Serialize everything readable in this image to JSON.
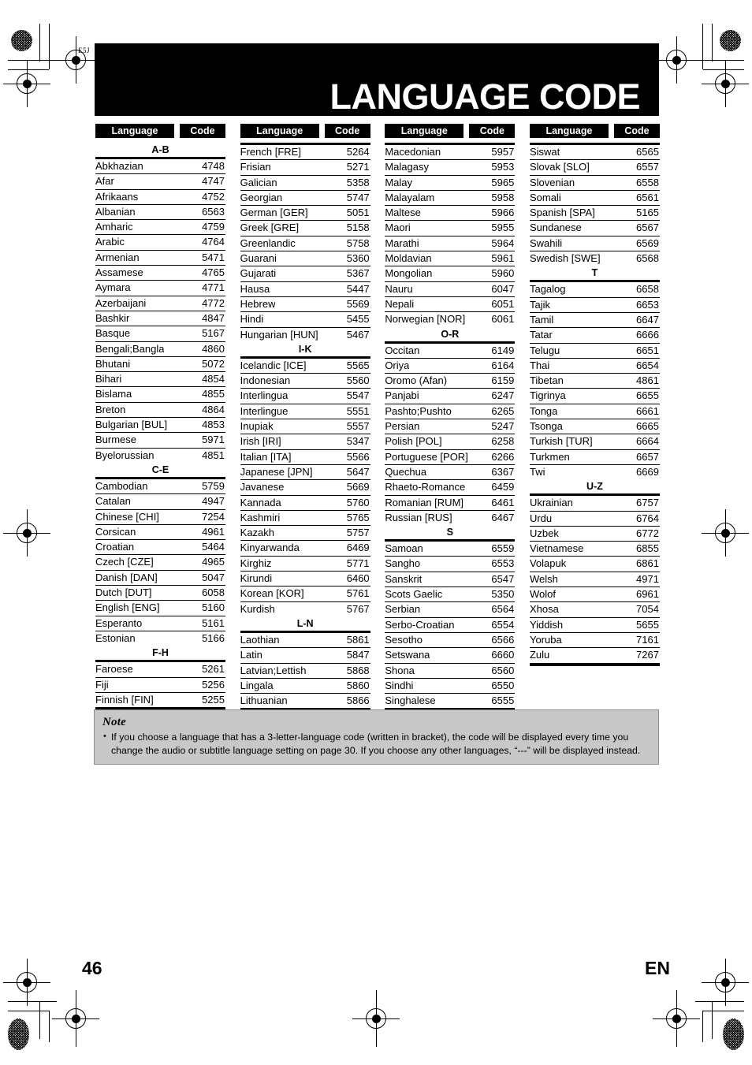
{
  "document": {
    "title": "LANGUAGE CODE",
    "corner_mark": "E5J",
    "page_number": "46",
    "page_language": "EN"
  },
  "table": {
    "header": {
      "language": "Language",
      "code": "Code"
    },
    "columns": [
      {
        "groups": [
          {
            "section": "A-B",
            "rows": [
              {
                "language": "Abkhazian",
                "code": "4748"
              },
              {
                "language": "Afar",
                "code": "4747"
              },
              {
                "language": "Afrikaans",
                "code": "4752"
              },
              {
                "language": "Albanian",
                "code": "6563"
              },
              {
                "language": "Amharic",
                "code": "4759"
              },
              {
                "language": "Arabic",
                "code": "4764"
              },
              {
                "language": "Armenian",
                "code": "5471"
              },
              {
                "language": "Assamese",
                "code": "4765"
              },
              {
                "language": "Aymara",
                "code": "4771"
              },
              {
                "language": "Azerbaijani",
                "code": "4772"
              },
              {
                "language": "Bashkir",
                "code": "4847"
              },
              {
                "language": "Basque",
                "code": "5167"
              },
              {
                "language": "Bengali;Bangla",
                "code": "4860"
              },
              {
                "language": "Bhutani",
                "code": "5072"
              },
              {
                "language": "Bihari",
                "code": "4854"
              },
              {
                "language": "Bislama",
                "code": "4855"
              },
              {
                "language": "Breton",
                "code": "4864"
              },
              {
                "language": "Bulgarian [BUL]",
                "code": "4853"
              },
              {
                "language": "Burmese",
                "code": "5971"
              },
              {
                "language": "Byelorussian",
                "code": "4851"
              }
            ]
          },
          {
            "section": "C-E",
            "rows": [
              {
                "language": "Cambodian",
                "code": "5759"
              },
              {
                "language": "Catalan",
                "code": "4947"
              },
              {
                "language": "Chinese [CHI]",
                "code": "7254"
              },
              {
                "language": "Corsican",
                "code": "4961"
              },
              {
                "language": "Croatian",
                "code": "5464"
              },
              {
                "language": "Czech [CZE]",
                "code": "4965"
              },
              {
                "language": "Danish [DAN]",
                "code": "5047"
              },
              {
                "language": "Dutch [DUT]",
                "code": "6058"
              },
              {
                "language": "English [ENG]",
                "code": "5160"
              },
              {
                "language": "Esperanto",
                "code": "5161"
              },
              {
                "language": "Estonian",
                "code": "5166"
              }
            ]
          },
          {
            "section": "F-H",
            "rows": [
              {
                "language": "Faroese",
                "code": "5261"
              },
              {
                "language": "Fiji",
                "code": "5256"
              },
              {
                "language": "Finnish [FIN]",
                "code": "5255"
              }
            ]
          }
        ]
      },
      {
        "groups": [
          {
            "section": "",
            "rows": [
              {
                "language": "French [FRE]",
                "code": "5264"
              },
              {
                "language": "Frisian",
                "code": "5271"
              },
              {
                "language": "Galician",
                "code": "5358"
              },
              {
                "language": "Georgian",
                "code": "5747"
              },
              {
                "language": "German [GER]",
                "code": "5051"
              },
              {
                "language": "Greek [GRE]",
                "code": "5158"
              },
              {
                "language": "Greenlandic",
                "code": "5758"
              },
              {
                "language": "Guarani",
                "code": "5360"
              },
              {
                "language": "Gujarati",
                "code": "5367"
              },
              {
                "language": "Hausa",
                "code": "5447"
              },
              {
                "language": "Hebrew",
                "code": "5569"
              },
              {
                "language": "Hindi",
                "code": "5455"
              },
              {
                "language": "Hungarian [HUN]",
                "code": "5467"
              }
            ]
          },
          {
            "section": "I-K",
            "rows": [
              {
                "language": "Icelandic [ICE]",
                "code": "5565"
              },
              {
                "language": "Indonesian",
                "code": "5560"
              },
              {
                "language": "Interlingua",
                "code": "5547"
              },
              {
                "language": "Interlingue",
                "code": "5551"
              },
              {
                "language": "Inupiak",
                "code": "5557"
              },
              {
                "language": "Irish [IRI]",
                "code": "5347"
              },
              {
                "language": "Italian [ITA]",
                "code": "5566"
              },
              {
                "language": "Japanese [JPN]",
                "code": "5647"
              },
              {
                "language": "Javanese",
                "code": "5669"
              },
              {
                "language": "Kannada",
                "code": "5760"
              },
              {
                "language": "Kashmiri",
                "code": "5765"
              },
              {
                "language": "Kazakh",
                "code": "5757"
              },
              {
                "language": "Kinyarwanda",
                "code": "6469"
              },
              {
                "language": "Kirghiz",
                "code": "5771"
              },
              {
                "language": "Kirundi",
                "code": "6460"
              },
              {
                "language": "Korean [KOR]",
                "code": "5761"
              },
              {
                "language": "Kurdish",
                "code": "5767"
              }
            ]
          },
          {
            "section": "L-N",
            "rows": [
              {
                "language": "Laothian",
                "code": "5861"
              },
              {
                "language": "Latin",
                "code": "5847"
              },
              {
                "language": "Latvian;Lettish",
                "code": "5868"
              },
              {
                "language": "Lingala",
                "code": "5860"
              },
              {
                "language": "Lithuanian",
                "code": "5866"
              }
            ]
          }
        ]
      },
      {
        "groups": [
          {
            "section": "",
            "rows": [
              {
                "language": "Macedonian",
                "code": "5957"
              },
              {
                "language": "Malagasy",
                "code": "5953"
              },
              {
                "language": "Malay",
                "code": "5965"
              },
              {
                "language": "Malayalam",
                "code": "5958"
              },
              {
                "language": "Maltese",
                "code": "5966"
              },
              {
                "language": "Maori",
                "code": "5955"
              },
              {
                "language": "Marathi",
                "code": "5964"
              },
              {
                "language": "Moldavian",
                "code": "5961"
              },
              {
                "language": "Mongolian",
                "code": "5960"
              },
              {
                "language": "Nauru",
                "code": "6047"
              },
              {
                "language": "Nepali",
                "code": "6051"
              },
              {
                "language": "Norwegian [NOR]",
                "code": "6061"
              }
            ]
          },
          {
            "section": "O-R",
            "rows": [
              {
                "language": "Occitan",
                "code": "6149"
              },
              {
                "language": "Oriya",
                "code": "6164"
              },
              {
                "language": "Oromo (Afan)",
                "code": "6159"
              },
              {
                "language": "Panjabi",
                "code": "6247"
              },
              {
                "language": "Pashto;Pushto",
                "code": "6265"
              },
              {
                "language": "Persian",
                "code": "5247"
              },
              {
                "language": "Polish [POL]",
                "code": "6258"
              },
              {
                "language": "Portuguese [POR]",
                "code": "6266"
              },
              {
                "language": "Quechua",
                "code": "6367"
              },
              {
                "language": "Rhaeto-Romance",
                "code": "6459"
              },
              {
                "language": "Romanian [RUM]",
                "code": "6461"
              },
              {
                "language": "Russian [RUS]",
                "code": "6467"
              }
            ]
          },
          {
            "section": "S",
            "rows": [
              {
                "language": "Samoan",
                "code": "6559"
              },
              {
                "language": "Sangho",
                "code": "6553"
              },
              {
                "language": "Sanskrit",
                "code": "6547"
              },
              {
                "language": "Scots Gaelic",
                "code": "5350"
              },
              {
                "language": "Serbian",
                "code": "6564"
              },
              {
                "language": "Serbo-Croatian",
                "code": "6554"
              },
              {
                "language": "Sesotho",
                "code": "6566"
              },
              {
                "language": "Setswana",
                "code": "6660"
              },
              {
                "language": "Shona",
                "code": "6560"
              },
              {
                "language": "Sindhi",
                "code": "6550"
              },
              {
                "language": "Singhalese",
                "code": "6555"
              }
            ]
          }
        ]
      },
      {
        "groups": [
          {
            "section": "",
            "rows": [
              {
                "language": "Siswat",
                "code": "6565"
              },
              {
                "language": "Slovak [SLO]",
                "code": "6557"
              },
              {
                "language": "Slovenian",
                "code": "6558"
              },
              {
                "language": "Somali",
                "code": "6561"
              },
              {
                "language": "Spanish [SPA]",
                "code": "5165"
              },
              {
                "language": "Sundanese",
                "code": "6567"
              },
              {
                "language": "Swahili",
                "code": "6569"
              },
              {
                "language": "Swedish [SWE]",
                "code": "6568"
              }
            ]
          },
          {
            "section": "T",
            "rows": [
              {
                "language": "Tagalog",
                "code": "6658"
              },
              {
                "language": "Tajik",
                "code": "6653"
              },
              {
                "language": "Tamil",
                "code": "6647"
              },
              {
                "language": "Tatar",
                "code": "6666"
              },
              {
                "language": "Telugu",
                "code": "6651"
              },
              {
                "language": "Thai",
                "code": "6654"
              },
              {
                "language": "Tibetan",
                "code": "4861"
              },
              {
                "language": "Tigrinya",
                "code": "6655"
              },
              {
                "language": "Tonga",
                "code": "6661"
              },
              {
                "language": "Tsonga",
                "code": "6665"
              },
              {
                "language": "Turkish [TUR]",
                "code": "6664"
              },
              {
                "language": "Turkmen",
                "code": "6657"
              },
              {
                "language": "Twi",
                "code": "6669"
              }
            ]
          },
          {
            "section": "U-Z",
            "rows": [
              {
                "language": "Ukrainian",
                "code": "6757"
              },
              {
                "language": "Urdu",
                "code": "6764"
              },
              {
                "language": "Uzbek",
                "code": "6772"
              },
              {
                "language": "Vietnamese",
                "code": "6855"
              },
              {
                "language": "Volapuk",
                "code": "6861"
              },
              {
                "language": "Welsh",
                "code": "4971"
              },
              {
                "language": "Wolof",
                "code": "6961"
              },
              {
                "language": "Xhosa",
                "code": "7054"
              },
              {
                "language": "Yiddish",
                "code": "5655"
              },
              {
                "language": "Yoruba",
                "code": "7161"
              },
              {
                "language": "Zulu",
                "code": "7267"
              }
            ]
          }
        ]
      }
    ]
  },
  "note": {
    "heading": "Note",
    "items": [
      "If you choose a language that has a 3-letter-language code (written in bracket), the code will be displayed every time you change the audio or subtitle language setting on page 30. If you choose any other languages, “---” will be displayed instead."
    ]
  },
  "colors": {
    "ink": "#000000",
    "note_background": "#c8c8c8",
    "note_border": "#8c8c8c"
  }
}
